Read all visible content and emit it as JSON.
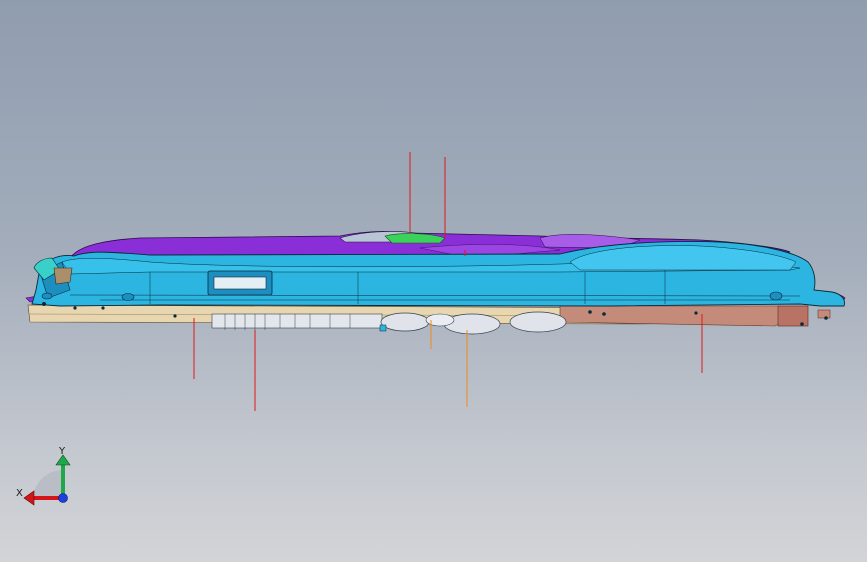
{
  "viewport": {
    "background_top": "#909daf",
    "background_bottom": "#d2d4d7"
  },
  "model": {
    "colors": {
      "main_body": "#2bb5e0",
      "main_body_dark": "#1c8fc0",
      "top_cover": "#8a2fd8",
      "top_cover_light": "#a85de8",
      "green_part": "#3ad25a",
      "base_plate": "#e7d6b0",
      "copper_part": "#c48b7a",
      "lower_parts": "#d9dee6",
      "edge_lines": "#0a2a3a"
    },
    "dimension_lines": {
      "red": "#e01818",
      "orange": "#ef8a1c"
    }
  },
  "triad": {
    "x_label": "X",
    "y_label": "Y",
    "x_color": "#d4161b",
    "y_color": "#1fa84a",
    "z_color": "#1d3ee0"
  }
}
